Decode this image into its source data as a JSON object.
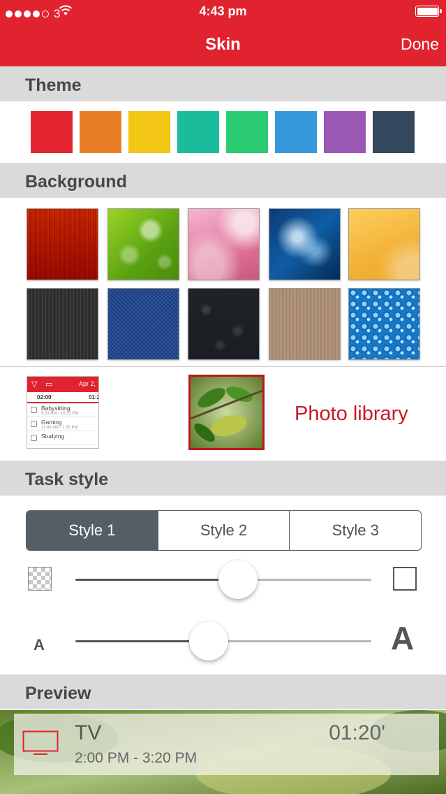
{
  "status_bar": {
    "carrier": "3",
    "time": "4:43 pm"
  },
  "nav": {
    "title": "Skin",
    "done_label": "Done"
  },
  "sections": {
    "theme": "Theme",
    "background": "Background",
    "task_style": "Task style",
    "preview": "Preview"
  },
  "theme_colors": [
    "#e32530",
    "#e87f25",
    "#f3c515",
    "#1bbc9b",
    "#2bcb71",
    "#3598db",
    "#9b59b6",
    "#34495e"
  ],
  "backgrounds": [
    "orange-wood",
    "green-bokeh",
    "pink-waves",
    "blue-abstract",
    "yellow-waves",
    "dark-wood",
    "denim",
    "black-leather",
    "light-wood",
    "water-drops"
  ],
  "custom_backgrounds": {
    "screenshot": {
      "date": "Apr 2,",
      "sub_left": "02:00'",
      "sub_right": "01:2",
      "rows": [
        {
          "name": "Babysitting",
          "time": "9:31 PM - 10:31 PM"
        },
        {
          "name": "Gaming",
          "time": "11:46 AM - 1:16 PM"
        },
        {
          "name": "Studying",
          "time": ""
        }
      ]
    },
    "photo_library_label": "Photo library"
  },
  "task_style": {
    "segments": [
      "Style 1",
      "Style 2",
      "Style 3"
    ],
    "selected": 0,
    "opacity_level": 0.55,
    "font_size_level": 0.45,
    "small_a": "A",
    "large_a": "A"
  },
  "preview_task": {
    "name": "TV",
    "duration": "01:20'",
    "time_range": "2:00 PM - 3:20 PM"
  }
}
